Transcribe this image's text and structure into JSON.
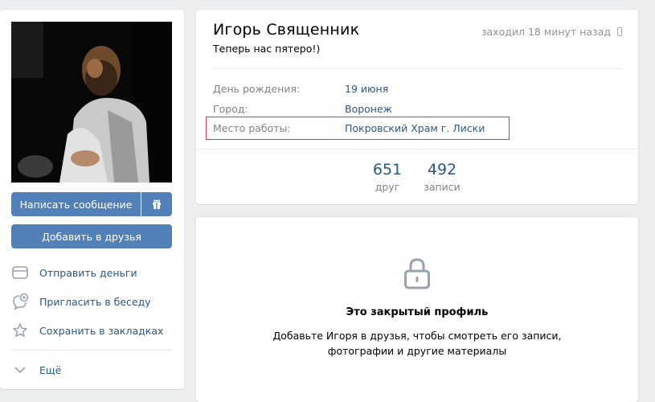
{
  "left_panel": {
    "message_button": "Написать сообщение",
    "gift_icon": "gift-icon",
    "add_friend_button": "Добавить в друзья",
    "actions": [
      {
        "label": "Отправить деньги",
        "icon": "wallet-icon"
      },
      {
        "label": "Пригласить в беседу",
        "icon": "chat-plus-icon"
      },
      {
        "label": "Сохранить в закладках",
        "icon": "star-icon"
      }
    ],
    "more": {
      "label": "Ещё",
      "icon": "chevron-down-icon"
    }
  },
  "profile": {
    "name": "Игорь Священник",
    "last_seen": "заходил 18 минут назад",
    "last_seen_icon": "mobile-phone-icon",
    "status": "Теперь нас пятеро!)",
    "info": [
      {
        "label": "День рождения:",
        "value": "19 июня"
      },
      {
        "label": "Город:",
        "value": "Воронеж"
      },
      {
        "label": "Место работы:",
        "value": "Покровский Храм г. Лиски"
      }
    ],
    "counters": [
      {
        "value": "651",
        "label": "друг"
      },
      {
        "value": "492",
        "label": "записи"
      }
    ]
  },
  "closed_profile": {
    "icon": "lock-icon",
    "title": "Это закрытый профиль",
    "text": "Добавьте Игоря в друзья, чтобы смотреть его записи, фотографии и другие материалы"
  },
  "colors": {
    "accent": "#5181b8",
    "link": "#2a5885",
    "highlight": "#d13f49",
    "background": "#edeef0"
  }
}
